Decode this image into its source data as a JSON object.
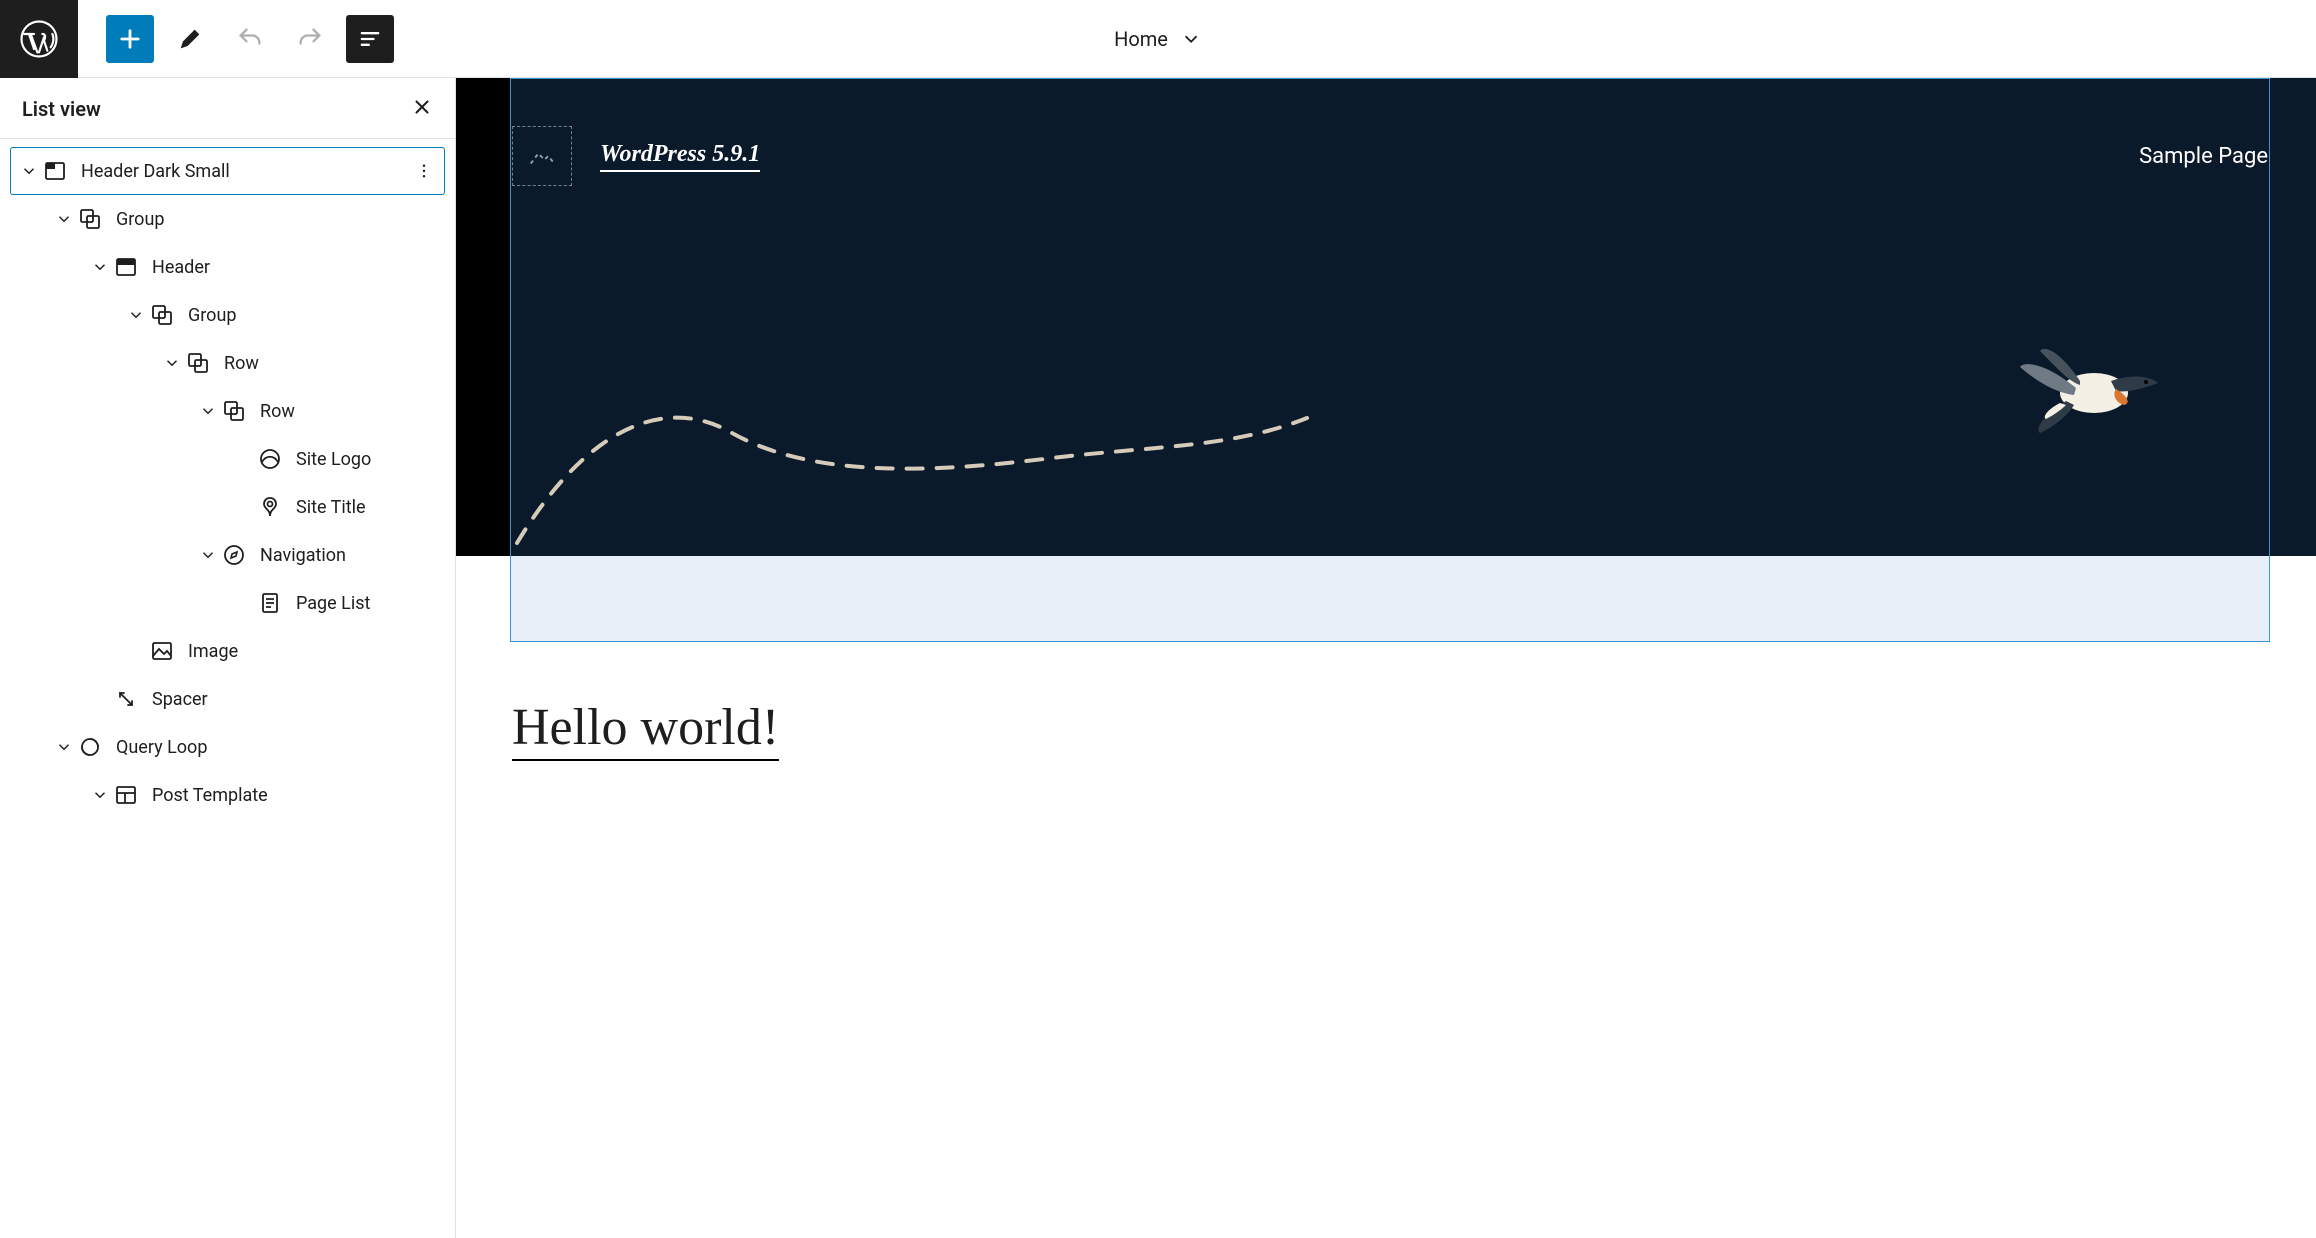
{
  "toolbar": {
    "document_title": "Home"
  },
  "listview": {
    "title": "List view",
    "tree": [
      {
        "label": "Header Dark Small",
        "icon": "template-part",
        "indent": 0,
        "expanded": true,
        "selected": true,
        "more": true
      },
      {
        "label": "Group",
        "icon": "group",
        "indent": 1,
        "expanded": true
      },
      {
        "label": "Header",
        "icon": "header",
        "indent": 2,
        "expanded": true
      },
      {
        "label": "Group",
        "icon": "group",
        "indent": 3,
        "expanded": true
      },
      {
        "label": "Row",
        "icon": "group",
        "indent": 4,
        "expanded": true
      },
      {
        "label": "Row",
        "icon": "group",
        "indent": 5,
        "expanded": true
      },
      {
        "label": "Site Logo",
        "icon": "site-logo",
        "indent": 6
      },
      {
        "label": "Site Title",
        "icon": "site-title",
        "indent": 6
      },
      {
        "label": "Navigation",
        "icon": "navigation",
        "indent": 5,
        "expanded": true
      },
      {
        "label": "Page List",
        "icon": "page-list",
        "indent": 6
      },
      {
        "label": "Image",
        "icon": "image",
        "indent": 3
      },
      {
        "label": "Spacer",
        "icon": "spacer",
        "indent": 2
      },
      {
        "label": "Query Loop",
        "icon": "query-loop",
        "indent": 1,
        "expanded": true
      },
      {
        "label": "Post Template",
        "icon": "post-template",
        "indent": 2,
        "expanded": true
      }
    ]
  },
  "canvas": {
    "site_title": "WordPress 5.9.1",
    "nav_link": "Sample Page",
    "post_title": "Hello world!"
  }
}
